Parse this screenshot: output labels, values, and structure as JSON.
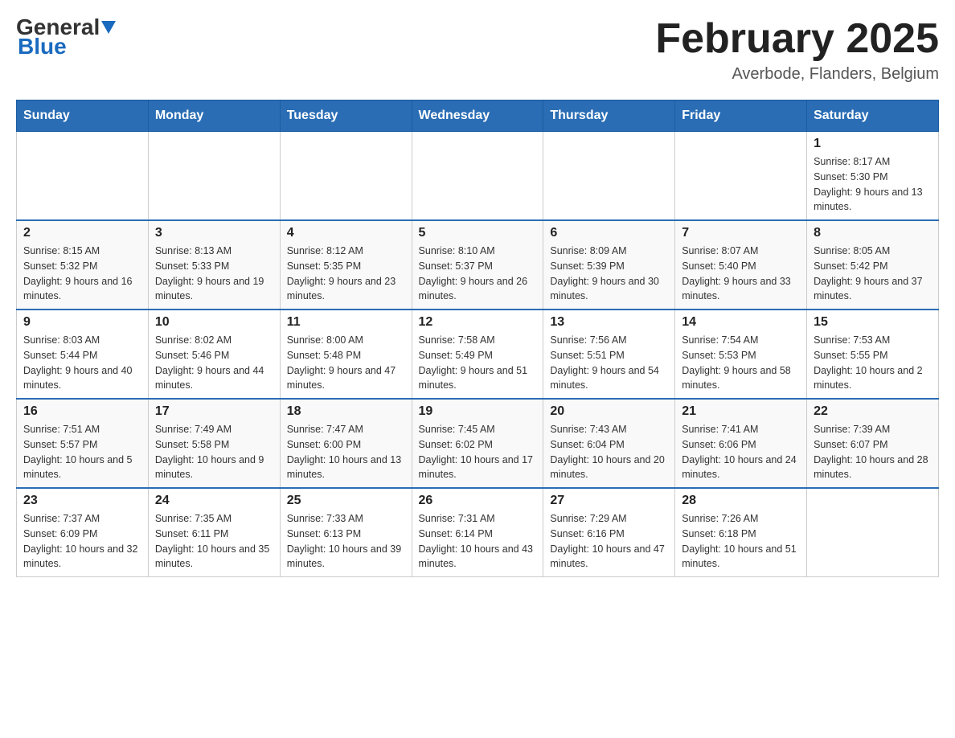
{
  "header": {
    "logo_general": "General",
    "logo_blue": "Blue",
    "month_title": "February 2025",
    "location": "Averbode, Flanders, Belgium"
  },
  "days_of_week": [
    "Sunday",
    "Monday",
    "Tuesday",
    "Wednesday",
    "Thursday",
    "Friday",
    "Saturday"
  ],
  "weeks": [
    [
      {
        "day": "",
        "info": ""
      },
      {
        "day": "",
        "info": ""
      },
      {
        "day": "",
        "info": ""
      },
      {
        "day": "",
        "info": ""
      },
      {
        "day": "",
        "info": ""
      },
      {
        "day": "",
        "info": ""
      },
      {
        "day": "1",
        "info": "Sunrise: 8:17 AM\nSunset: 5:30 PM\nDaylight: 9 hours and 13 minutes."
      }
    ],
    [
      {
        "day": "2",
        "info": "Sunrise: 8:15 AM\nSunset: 5:32 PM\nDaylight: 9 hours and 16 minutes."
      },
      {
        "day": "3",
        "info": "Sunrise: 8:13 AM\nSunset: 5:33 PM\nDaylight: 9 hours and 19 minutes."
      },
      {
        "day": "4",
        "info": "Sunrise: 8:12 AM\nSunset: 5:35 PM\nDaylight: 9 hours and 23 minutes."
      },
      {
        "day": "5",
        "info": "Sunrise: 8:10 AM\nSunset: 5:37 PM\nDaylight: 9 hours and 26 minutes."
      },
      {
        "day": "6",
        "info": "Sunrise: 8:09 AM\nSunset: 5:39 PM\nDaylight: 9 hours and 30 minutes."
      },
      {
        "day": "7",
        "info": "Sunrise: 8:07 AM\nSunset: 5:40 PM\nDaylight: 9 hours and 33 minutes."
      },
      {
        "day": "8",
        "info": "Sunrise: 8:05 AM\nSunset: 5:42 PM\nDaylight: 9 hours and 37 minutes."
      }
    ],
    [
      {
        "day": "9",
        "info": "Sunrise: 8:03 AM\nSunset: 5:44 PM\nDaylight: 9 hours and 40 minutes."
      },
      {
        "day": "10",
        "info": "Sunrise: 8:02 AM\nSunset: 5:46 PM\nDaylight: 9 hours and 44 minutes."
      },
      {
        "day": "11",
        "info": "Sunrise: 8:00 AM\nSunset: 5:48 PM\nDaylight: 9 hours and 47 minutes."
      },
      {
        "day": "12",
        "info": "Sunrise: 7:58 AM\nSunset: 5:49 PM\nDaylight: 9 hours and 51 minutes."
      },
      {
        "day": "13",
        "info": "Sunrise: 7:56 AM\nSunset: 5:51 PM\nDaylight: 9 hours and 54 minutes."
      },
      {
        "day": "14",
        "info": "Sunrise: 7:54 AM\nSunset: 5:53 PM\nDaylight: 9 hours and 58 minutes."
      },
      {
        "day": "15",
        "info": "Sunrise: 7:53 AM\nSunset: 5:55 PM\nDaylight: 10 hours and 2 minutes."
      }
    ],
    [
      {
        "day": "16",
        "info": "Sunrise: 7:51 AM\nSunset: 5:57 PM\nDaylight: 10 hours and 5 minutes."
      },
      {
        "day": "17",
        "info": "Sunrise: 7:49 AM\nSunset: 5:58 PM\nDaylight: 10 hours and 9 minutes."
      },
      {
        "day": "18",
        "info": "Sunrise: 7:47 AM\nSunset: 6:00 PM\nDaylight: 10 hours and 13 minutes."
      },
      {
        "day": "19",
        "info": "Sunrise: 7:45 AM\nSunset: 6:02 PM\nDaylight: 10 hours and 17 minutes."
      },
      {
        "day": "20",
        "info": "Sunrise: 7:43 AM\nSunset: 6:04 PM\nDaylight: 10 hours and 20 minutes."
      },
      {
        "day": "21",
        "info": "Sunrise: 7:41 AM\nSunset: 6:06 PM\nDaylight: 10 hours and 24 minutes."
      },
      {
        "day": "22",
        "info": "Sunrise: 7:39 AM\nSunset: 6:07 PM\nDaylight: 10 hours and 28 minutes."
      }
    ],
    [
      {
        "day": "23",
        "info": "Sunrise: 7:37 AM\nSunset: 6:09 PM\nDaylight: 10 hours and 32 minutes."
      },
      {
        "day": "24",
        "info": "Sunrise: 7:35 AM\nSunset: 6:11 PM\nDaylight: 10 hours and 35 minutes."
      },
      {
        "day": "25",
        "info": "Sunrise: 7:33 AM\nSunset: 6:13 PM\nDaylight: 10 hours and 39 minutes."
      },
      {
        "day": "26",
        "info": "Sunrise: 7:31 AM\nSunset: 6:14 PM\nDaylight: 10 hours and 43 minutes."
      },
      {
        "day": "27",
        "info": "Sunrise: 7:29 AM\nSunset: 6:16 PM\nDaylight: 10 hours and 47 minutes."
      },
      {
        "day": "28",
        "info": "Sunrise: 7:26 AM\nSunset: 6:18 PM\nDaylight: 10 hours and 51 minutes."
      },
      {
        "day": "",
        "info": ""
      }
    ]
  ]
}
